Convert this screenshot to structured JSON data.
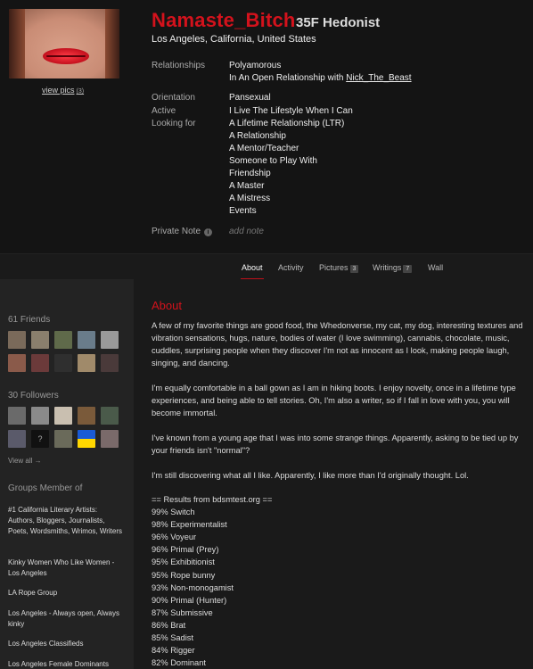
{
  "profile": {
    "username": "Namaste_Bitch",
    "info": "35F Hedonist",
    "location": "Los Angeles, California, United States",
    "view_pics_label": "view pics",
    "view_pics_count": "(3)",
    "relationships_label": "Relationships",
    "relationships": [
      "Polyamorous"
    ],
    "relationship_prefix": "In An Open Relationship with",
    "relationship_partner": "Nick_The_Beast",
    "orientation_label": "Orientation",
    "orientation": "Pansexual",
    "active_label": "Active",
    "active": "I Live The Lifestyle When I Can",
    "looking_label": "Looking for",
    "looking_for": [
      "A Lifetime Relationship (LTR)",
      "A Relationship",
      "A Mentor/Teacher",
      "Someone to Play With",
      "Friendship",
      "A Master",
      "A Mistress",
      "Events"
    ],
    "private_note_label": "Private Note",
    "private_note_placeholder": "add note",
    "info_icon": "i"
  },
  "tabs": [
    {
      "label": "About",
      "badge": ""
    },
    {
      "label": "Activity",
      "badge": ""
    },
    {
      "label": "Pictures",
      "badge": "3"
    },
    {
      "label": "Writings",
      "badge": "7"
    },
    {
      "label": "Wall",
      "badge": ""
    }
  ],
  "sidebar": {
    "friends_title": "61 Friends",
    "followers_title": "30 Followers",
    "view_all": "View all →",
    "groups_title": "Groups Member of",
    "friend_avatar_colors": [
      "#7a6a5a",
      "#8a7f6d",
      "#5f6a4a",
      "#6a7c8a",
      "#9a9a9a",
      "#8a5a4a",
      "#6b3a3a",
      "#2f2f2f",
      "#a08a6a",
      "#4a3a3a"
    ],
    "follower_avatar_colors": [
      "#6a6a6a",
      "#8a8a8a",
      "#c9bfb0",
      "#7a5a3a",
      "#4a5a4a",
      "#5a5a6a",
      "#111111",
      "#6a6a5a",
      "#ffd700",
      "#7a6a6a"
    ],
    "follower_placeholder": "?",
    "groups": [
      "#1 California Literary Artists: Authors, Bloggers, Journalists, Poets, Wordsmiths, Wrimos, Writers",
      "Kinky Women Who Like Women - Los Angeles",
      "LA Rope Group",
      "Los Angeles - Always open, Always kinky",
      "Los Angeles Classifieds",
      "Los Angeles Female Dominants"
    ]
  },
  "about": {
    "title": "About",
    "paragraphs": [
      "A few of my favorite things are good food, the Whedonverse, my cat, my dog, interesting textures and vibration sensations, hugs, nature, bodies of water (I love swimming), cannabis, chocolate, music, cuddles, surprising people when they discover I'm not as innocent as I look, making people laugh, singing, and dancing.",
      "I'm equally comfortable in a ball gown as I am in hiking boots. I enjoy novelty, once in a lifetime type experiences, and being able to tell stories. Oh, I'm also a writer, so if I fall in love with you, you will become immortal.",
      "I've known from a young age that I was into some strange things. Apparently, asking to be tied up by your friends isn't \"normal\"?",
      "I'm still discovering what all I like. Apparently, I like more than I'd originally thought. Lol."
    ],
    "results_header": "== Results from bdsmtest.org ==",
    "results": [
      "99% Switch",
      "98% Experimentalist",
      "96% Voyeur",
      "96% Primal (Prey)",
      "95% Exhibitionist",
      "95% Rope bunny",
      "93% Non-monogamist",
      "90% Primal (Hunter)",
      "87% Submissive",
      "86% Brat",
      "85% Sadist",
      "84% Rigger",
      "82% Dominant"
    ]
  },
  "colors": {
    "accent": "#d3121c",
    "header_bg": "#141414",
    "sidebar_bg": "#232323",
    "main_bg": "#1a1a1a"
  }
}
